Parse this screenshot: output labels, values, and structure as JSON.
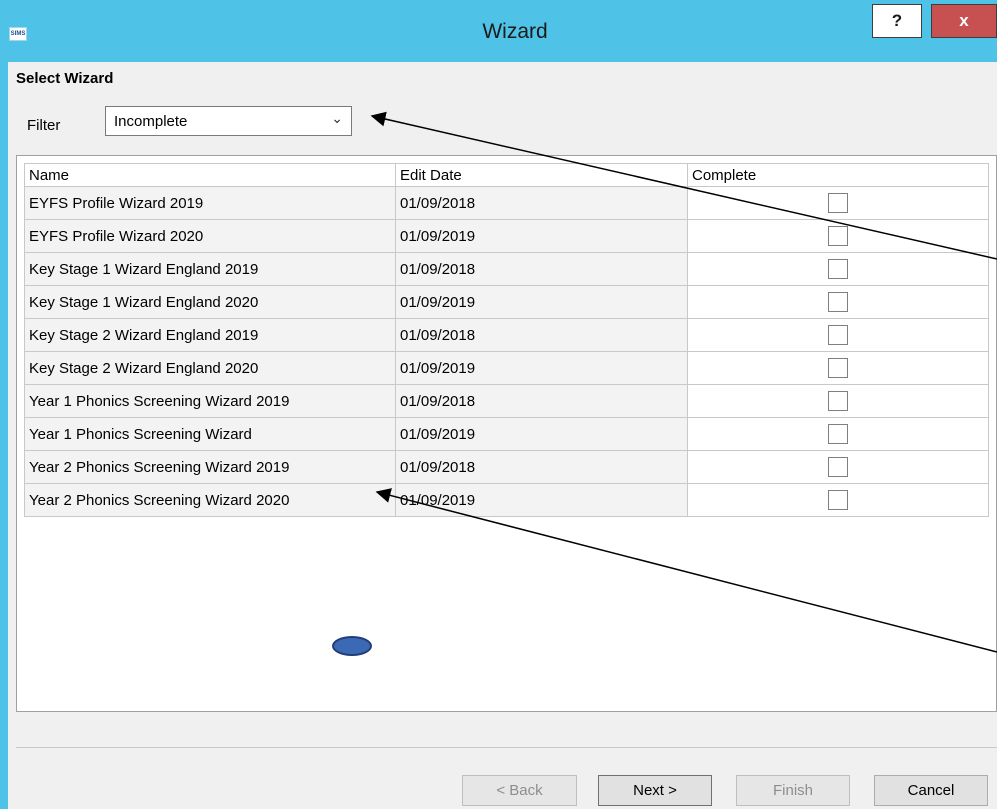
{
  "window": {
    "title": "Wizard",
    "app_icon_text": "SIMS",
    "help_label": "?",
    "close_label": "x"
  },
  "panel": {
    "section_title": "Select Wizard",
    "filter_label": "Filter",
    "filter_value": "Incomplete"
  },
  "grid": {
    "headers": [
      "Name",
      "Edit Date",
      "Complete"
    ],
    "rows": [
      {
        "name": "EYFS Profile Wizard 2019",
        "date": "01/09/2018",
        "complete": false
      },
      {
        "name": "EYFS Profile Wizard 2020",
        "date": "01/09/2019",
        "complete": false
      },
      {
        "name": "Key Stage 1 Wizard England 2019",
        "date": "01/09/2018",
        "complete": false
      },
      {
        "name": "Key Stage 1 Wizard England 2020",
        "date": "01/09/2019",
        "complete": false
      },
      {
        "name": "Key Stage 2 Wizard England 2019",
        "date": "01/09/2018",
        "complete": false
      },
      {
        "name": "Key Stage 2 Wizard England 2020",
        "date": "01/09/2019",
        "complete": false
      },
      {
        "name": "Year 1 Phonics Screening Wizard 2019",
        "date": "01/09/2018",
        "complete": false
      },
      {
        "name": "Year 1 Phonics Screening Wizard",
        "date": "01/09/2019",
        "complete": false
      },
      {
        "name": "Year 2 Phonics Screening Wizard 2019",
        "date": "01/09/2018",
        "complete": false
      },
      {
        "name": "Year 2 Phonics Screening Wizard 2020",
        "date": "01/09/2019",
        "complete": false
      }
    ]
  },
  "buttons": {
    "back": "< Back",
    "next": "Next >",
    "finish": "Finish",
    "cancel": "Cancel"
  },
  "colors": {
    "title_bar": "#4fc3e7",
    "close_button": "#c75050",
    "dialog_background": "#f0f0f0"
  }
}
